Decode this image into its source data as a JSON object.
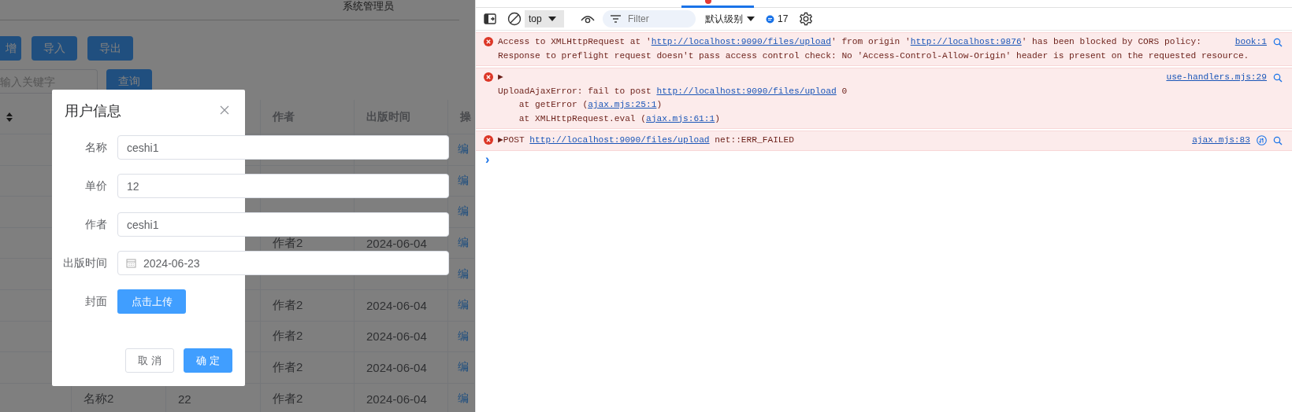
{
  "app": {
    "user_menu": {
      "label": "系统管理员"
    },
    "toolbar_buttons": [
      {
        "label": "增"
      },
      {
        "label": "导入"
      },
      {
        "label": "导出"
      }
    ],
    "search": {
      "placeholder": "输入关键字",
      "button": "查询"
    },
    "table": {
      "columns": [
        {
          "kind": "sort"
        },
        {
          "kind": "blank"
        },
        {
          "kind": "blank"
        },
        {
          "kind": "text",
          "label": "作者"
        },
        {
          "kind": "text",
          "label": "出版时间"
        },
        {
          "kind": "text",
          "label": "操"
        }
      ],
      "rows": [
        {
          "action": "编"
        },
        {
          "action": "编"
        },
        {
          "action": "编"
        },
        {
          "author": "作者2",
          "date": "2024-06-04",
          "action": "编"
        },
        {
          "action": "编"
        },
        {
          "author": "作者2",
          "date": "2024-06-04",
          "action": "编"
        },
        {
          "author": "作者2",
          "date": "2024-06-04",
          "action": "编"
        },
        {
          "author": "作者2",
          "date": "2024-06-04",
          "action": "编"
        },
        {
          "name": "名称2",
          "price": "22",
          "author": "作者2",
          "date": "2024-06-04",
          "action": "编"
        }
      ]
    },
    "dialog": {
      "title": "用户信息",
      "fields": [
        {
          "label": "名称",
          "value": "ceshi1",
          "kind": "text"
        },
        {
          "label": "单价",
          "value": "12",
          "kind": "text"
        },
        {
          "label": "作者",
          "value": "ceshi1",
          "kind": "text"
        },
        {
          "label": "出版时间",
          "value": "2024-06-23",
          "kind": "date"
        }
      ],
      "upload": {
        "label": "封面",
        "button": "点击上传"
      },
      "buttons": [
        {
          "label": "取 消",
          "kind": "default"
        },
        {
          "label": "确 定",
          "kind": "primary"
        }
      ]
    }
  },
  "devtools": {
    "toolbar": {
      "context": "top",
      "filter_placeholder": "Filter",
      "level": "默认级别",
      "message_count": "17"
    },
    "messages": [
      {
        "kind": "console",
        "source": "book:1",
        "lines": [
          [
            {
              "text": "Access to XMLHttpRequest at '",
              "link": false
            },
            {
              "text": "http://localhost:9090/files/upload",
              "link": true
            },
            {
              "text": "' from origin '",
              "link": false
            },
            {
              "text": "http://localhost:9876",
              "link": true
            },
            {
              "text": "' has been blocked by CORS policy:",
              "link": false
            }
          ],
          [
            {
              "text": "Response to preflight request doesn't pass access control check: No 'Access-Control-Allow-Origin' header is present on the requested resource.",
              "link": false
            }
          ]
        ]
      },
      {
        "kind": "console",
        "source": "use-handlers.mjs:29",
        "lines": [
          [
            {
              "text": "▶",
              "link": false
            }
          ],
          [
            {
              "text": "UploadAjaxError: fail to post ",
              "link": false
            },
            {
              "text": "http://localhost:9090/files/upload",
              "link": true
            },
            {
              "text": " 0",
              "link": false
            }
          ],
          [
            {
              "text": "    at getError (",
              "link": false
            },
            {
              "text": "ajax.mjs:25:1",
              "link": true
            },
            {
              "text": ")",
              "link": false
            }
          ],
          [
            {
              "text": "    at XMLHttpRequest.eval (",
              "link": false
            },
            {
              "text": "ajax.mjs:61:1",
              "link": true
            },
            {
              "text": ")",
              "link": false
            }
          ]
        ]
      },
      {
        "kind": "network",
        "source": "ajax.mjs:83",
        "lines": [
          [
            {
              "text": "▶POST ",
              "link": false
            },
            {
              "text": "http://localhost:9090/files/upload",
              "link": true
            },
            {
              "text": " net::ERR_FAILED",
              "link": false
            }
          ]
        ]
      }
    ],
    "prompt": "›"
  }
}
